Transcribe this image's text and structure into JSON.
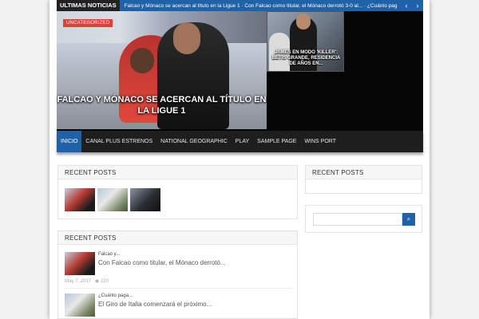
{
  "ticker": {
    "label": "ULTIMAS NOTICIAS",
    "text": "Falcao y Mónaco se acercan al título en la Ligue 1  ·  Con Falcao como titular, el Mónaco derrotó 3-0 al...  ·  ¿Cuánto pag",
    "prev_icon": "chevron-left-icon",
    "next_icon": "chevron-right-icon",
    "prev_glyph": "‹",
    "next_glyph": "›"
  },
  "hero": {
    "badge": "UNCATEGORIZED",
    "main_title": "FALCAO Y MÓNACO SE ACERCAN AL TÍTULO EN LA LIGUE 1",
    "side_title": "JAMES EN MODO 'KILLER': BETIS GRANDE, RESIDENCIA DE AÑOS EN..."
  },
  "nav": {
    "items": [
      "INICIO",
      "CANAL PLUS ESTRENOS",
      "NATIONAL GEOGRAPHIC",
      "PLAY",
      "SAMPLE PAGE",
      "WINS PORT"
    ]
  },
  "widgets": {
    "recent_posts_thumbs_title": "RECENT POSTS",
    "recent_posts_list_title": "RECENT POSTS",
    "sidebar_recent_title": "RECENT POSTS",
    "posts": [
      {
        "category": "Falcao y...",
        "title": "Con Falcao como titular, el Mónaco derrotó...",
        "date": "May 7, 2017",
        "views": "220"
      },
      {
        "category": "¿Cuánto paga...",
        "title": "El Giro de Italia comenzará el próximo...",
        "date": "",
        "views": ""
      }
    ],
    "search": {
      "placeholder": "",
      "icon": "search-icon",
      "glyph": "⌕"
    }
  },
  "colors": {
    "accent": "#1f62a8",
    "badge": "#d9433a",
    "nav_bg": "#1e1e1e"
  }
}
